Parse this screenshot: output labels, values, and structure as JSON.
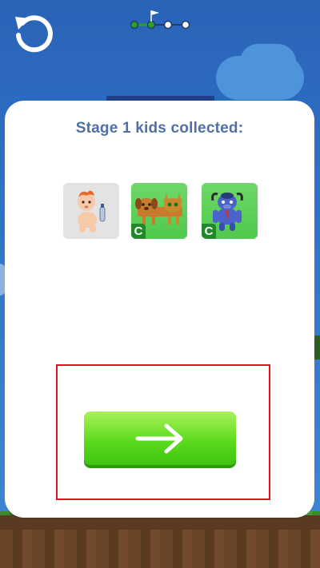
{
  "toolbar": {
    "undo_icon": "undo-icon"
  },
  "progress": {
    "total_nodes": 4,
    "current_node": 2,
    "completed_color": "#2aa02a",
    "flag_icon": "flag-icon"
  },
  "panel": {
    "title": "Stage 1 kids collected:"
  },
  "kids": [
    {
      "name": "baby-kid-icon",
      "badge": "",
      "background": "#e3e3e3"
    },
    {
      "name": "dog-cat-kid-icon",
      "badge": "C",
      "background": "#5ccf57"
    },
    {
      "name": "buffalo-kid-icon",
      "badge": "C",
      "background": "#5ccf57"
    }
  ],
  "next_button": {
    "icon": "arrow-right-icon",
    "color": "#5ddb1e"
  },
  "colors": {
    "title": "#4f6fa5",
    "highlight": "#e0141c",
    "sky": "#2f73c8"
  }
}
